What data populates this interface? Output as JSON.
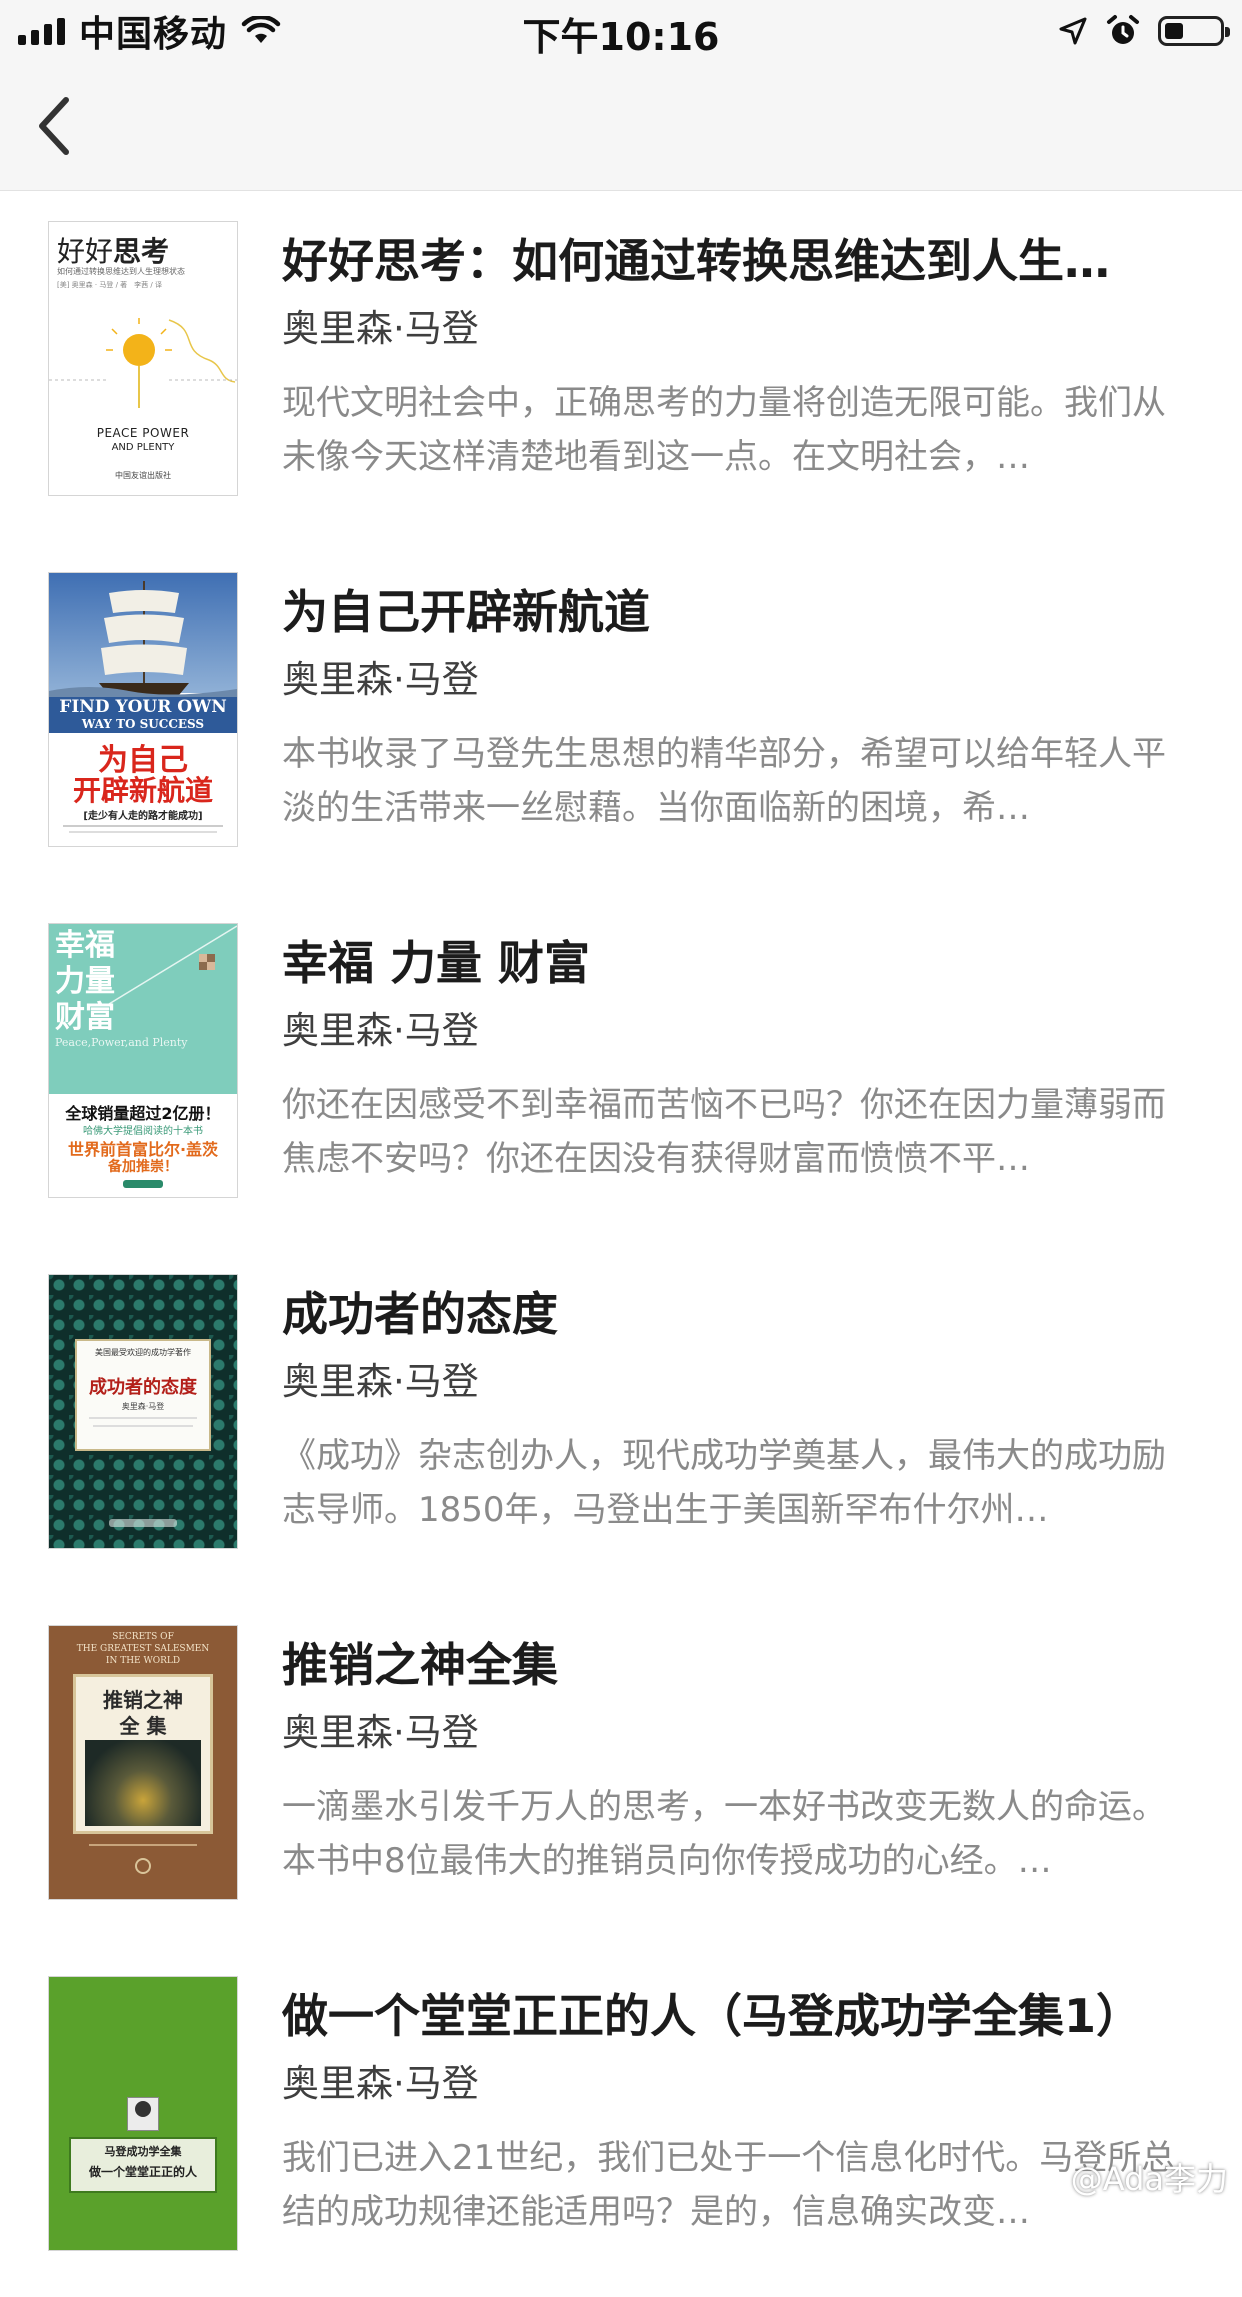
{
  "status_bar": {
    "carrier": "中国移动",
    "time": "下午10:16"
  },
  "books": [
    {
      "title": "好好思考：如何通过转换思维达到人生…",
      "author": "奥里森·马登",
      "description": "现代文明社会中，正确思考的力量将创造无限可能。我们从未像今天这样清楚地看到这一点。在文明社会，…",
      "cover": {
        "title": "好好",
        "title_em": "思考",
        "subtitle": "如何通过转换思维达到人生理想状态",
        "author_line": "[美] 奥里森 · 马登 / 著　李茜 / 译",
        "en1": "PEACE POWER",
        "en2": "AND PLENTY",
        "publisher": "中国友谊出版社"
      }
    },
    {
      "title": "为自己开辟新航道",
      "author": "奥里森·马登",
      "description": "本书收录了马登先生思想的精华部分，希望可以给年轻人平淡的生活带来一丝慰藉。当你面临新的困境，希…",
      "cover": {
        "en1": "FIND YOUR OWN",
        "en2": "WAY TO SUCCESS",
        "title1": "为自己",
        "title2": "开辟新航道",
        "tag": "[走少有人走的路才能成功]"
      }
    },
    {
      "title": "幸福 力量 财富",
      "author": "奥里森·马登",
      "description": "你还在因感受不到幸福而苦恼不已吗？你还在因力量薄弱而焦虑不安吗？你还在因没有获得财富而愤愤不平…",
      "cover": {
        "line1": "幸福",
        "line2": "力量",
        "line3": "财富",
        "en": "Peace,Power,and Plenty",
        "banner1": "全球销量超过2亿册！",
        "banner2": "哈佛大学提倡阅读的十本书",
        "banner3": "世界前首富比尔·盖茨",
        "banner4": "备加推崇！"
      }
    },
    {
      "title": "成功者的态度",
      "author": "奥里森·马登",
      "description": "《成功》杂志创办人，现代成功学奠基人，最伟大的成功励志导师。1850年，马登出生于美国新罕布什尔州…",
      "cover": {
        "top": "美国最受欢迎的成功学著作",
        "title": "成功者的态度",
        "author_line": "奥里森·马登"
      }
    },
    {
      "title": "推销之神全集",
      "author": "奥里森·马登",
      "description": "一滴墨水引发千万人的思考，一本好书改变无数人的命运。本书中8位最伟大的推销员向你传授成功的心经。…",
      "cover": {
        "en_top": "SECRETS OF",
        "en_mid": "THE GREATEST SALESMEN",
        "en_bot": "IN THE WORLD",
        "title1": "推销之神",
        "title2": "全 集"
      }
    },
    {
      "title": "做一个堂堂正正的人（马登成功学全集1）",
      "author": "奥里森·马登",
      "description": "我们已进入21世纪，我们已处于一个信息化时代。马登所总结的成功规律还能适用吗？是的，信息确实改变…",
      "cover": {
        "series": "马登成功学全集",
        "title": "做一个堂堂正正的人"
      }
    }
  ],
  "watermark": "@Ada李力"
}
